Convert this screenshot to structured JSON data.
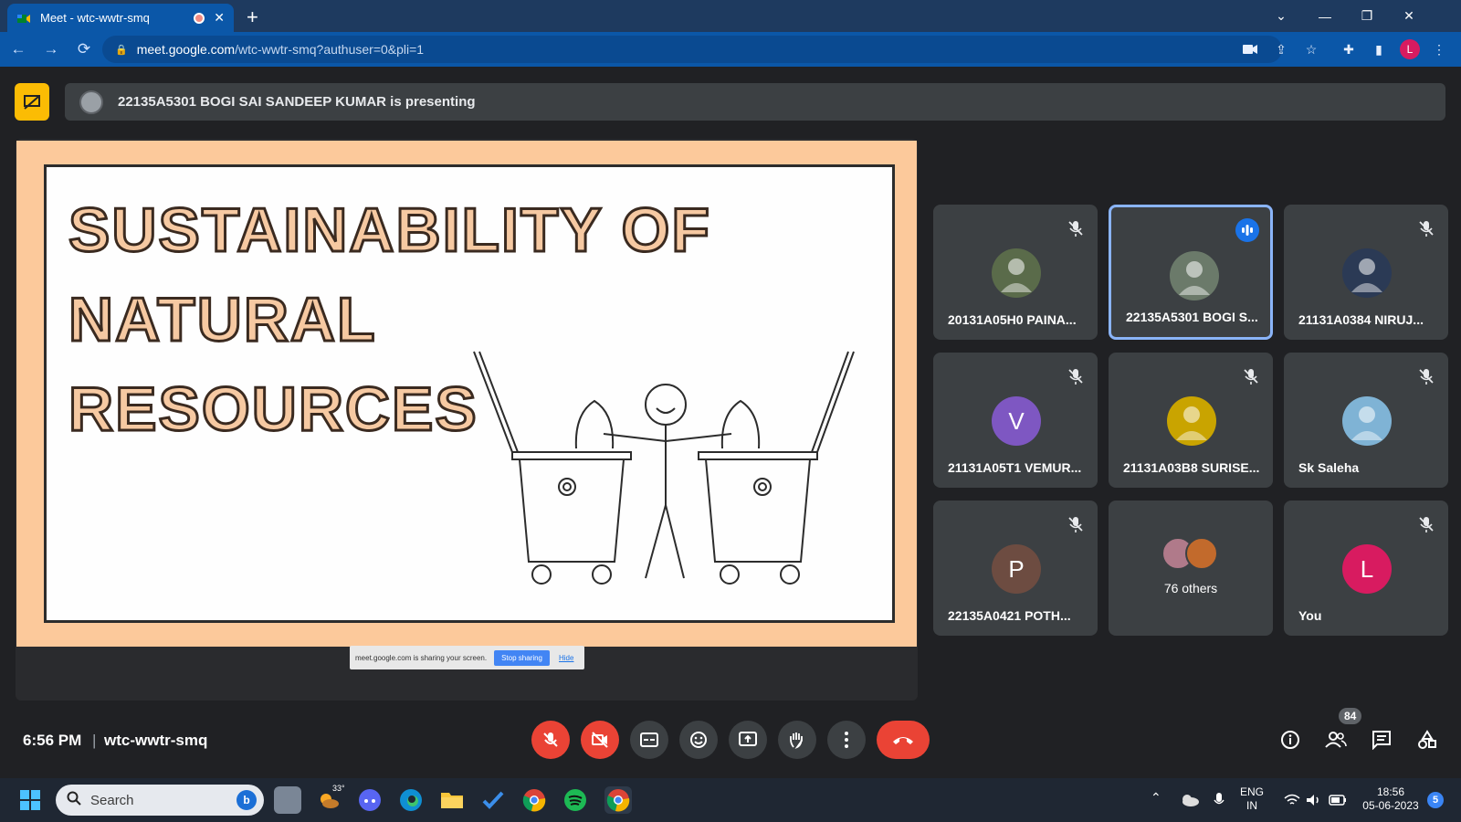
{
  "browser": {
    "tab_title": "Meet - wtc-wwtr-smq",
    "url_host": "meet.google.com",
    "url_path": "/wtc-wwtr-smq?authuser=0&pli=1",
    "profile_initial": "L"
  },
  "presenting_banner": "22135A5301 BOGI SAI SANDEEP KUMAR is presenting",
  "slide": {
    "title_lines": [
      "SUSTAINABILITY OF",
      "NATURAL",
      "RESOURCES"
    ]
  },
  "share_notice": {
    "text": "meet.google.com is sharing your screen.",
    "stop_label": "Stop sharing",
    "hide_label": "Hide"
  },
  "participants": [
    {
      "name": "20131A05H0 PAINA...",
      "muted": true,
      "avatar": "photo",
      "color": "#5a6b4a"
    },
    {
      "name": "22135A5301 BOGI S...",
      "muted": false,
      "speaking": true,
      "avatar": "photo",
      "color": "#6b7a6a"
    },
    {
      "name": "21131A0384 NIRUJ...",
      "muted": true,
      "avatar": "photo",
      "color": "#2b3a55"
    },
    {
      "name": "21131A05T1 VEMUR...",
      "muted": true,
      "avatar": "V",
      "color": "#7e57c2"
    },
    {
      "name": "21131A03B8 SURISE...",
      "muted": true,
      "avatar": "photo",
      "color": "#c9a400"
    },
    {
      "name": "Sk Saleha",
      "muted": true,
      "avatar": "photo",
      "color": "#7fb3d5"
    },
    {
      "name": "22135A0421 POTH...",
      "muted": true,
      "avatar": "P",
      "color": "#6d4c41"
    },
    {
      "others": "76 others"
    },
    {
      "name": "You",
      "muted": true,
      "avatar": "L",
      "color": "#d81b60"
    }
  ],
  "meeting": {
    "time": "6:56 PM",
    "separator": "|",
    "code": "wtc-wwtr-smq",
    "participant_count": "84"
  },
  "taskbar": {
    "search_placeholder": "Search",
    "weather_temp": "33°",
    "lang_line1": "ENG",
    "lang_line2": "IN",
    "clock_time": "18:56",
    "clock_date": "05-06-2023",
    "notification_count": "5"
  }
}
